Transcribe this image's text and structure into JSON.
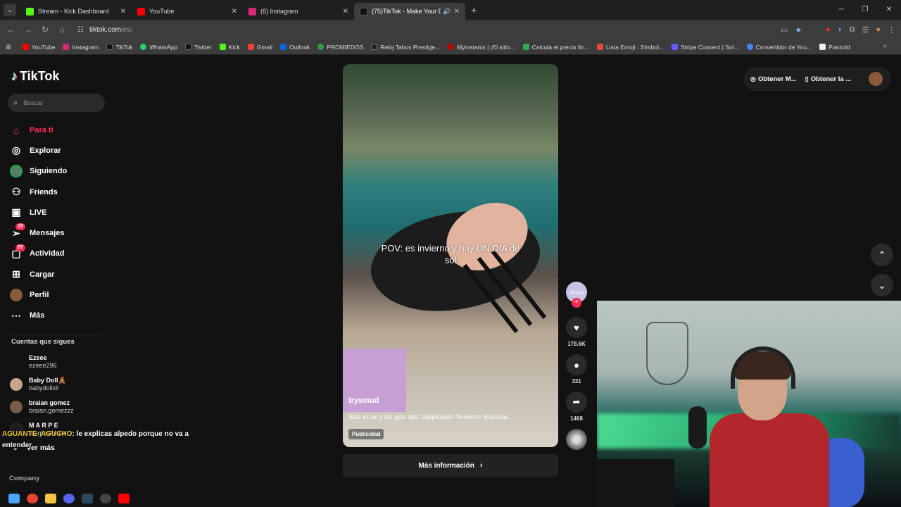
{
  "tabs": [
    {
      "label": "Stream - Kick Dashboard",
      "color": "#53fc18",
      "active": false
    },
    {
      "label": "YouTube",
      "color": "#ff0000",
      "active": false
    },
    {
      "label": "(6) Instagram",
      "color": "#d62976",
      "active": false
    },
    {
      "label": "(75)TikTok - Make Your Day",
      "color": "#111111",
      "active": true
    }
  ],
  "address": {
    "domain": "tiktok.com",
    "path": "/es/"
  },
  "bookmarks": [
    {
      "label": "YouTube",
      "color": "#ff0000"
    },
    {
      "label": "Instagram",
      "color": "#d62976"
    },
    {
      "label": "TikTok",
      "color": "#111111"
    },
    {
      "label": "WhatsApp",
      "color": "#25d366"
    },
    {
      "label": "Twitter",
      "color": "#111111"
    },
    {
      "label": "Kick",
      "color": "#53fc18"
    },
    {
      "label": "Gmail",
      "color": "#ea4335"
    },
    {
      "label": "Outlook",
      "color": "#0a64d6"
    },
    {
      "label": "PROMIEDOS",
      "color": "#2ea043"
    },
    {
      "label": "Reloj Tahos Prestige...",
      "color": "#222222"
    },
    {
      "label": "Myinstants | ¡El sitio...",
      "color": "#c00000"
    },
    {
      "label": "Calculá el precio fin...",
      "color": "#34a853"
    },
    {
      "label": "Lista Emoji : Símbol...",
      "color": "#e8453c"
    },
    {
      "label": "Stripe Connect | Sol...",
      "color": "#635bff"
    },
    {
      "label": "Convertidor de You...",
      "color": "#4285f4"
    },
    {
      "label": "Panzoid",
      "color": "#eeeeee"
    }
  ],
  "sidebar": {
    "logo": "TikTok",
    "search_placeholder": "Buscar",
    "nav": [
      {
        "label": "Para ti",
        "icon": "home-icon",
        "active": true
      },
      {
        "label": "Explorar",
        "icon": "compass-icon"
      },
      {
        "label": "Siguiendo",
        "icon": "following-avatar-icon"
      },
      {
        "label": "Friends",
        "icon": "friends-icon"
      },
      {
        "label": "LIVE",
        "icon": "live-icon"
      },
      {
        "label": "Mensajes",
        "icon": "messages-icon",
        "badge": "18"
      },
      {
        "label": "Actividad",
        "icon": "activity-icon",
        "badge": "57"
      },
      {
        "label": "Cargar",
        "icon": "upload-icon"
      },
      {
        "label": "Perfil",
        "icon": "profile-avatar-icon"
      },
      {
        "label": "Más",
        "icon": "more-icon"
      }
    ],
    "following_title": "Cuentas que sigues",
    "following": [
      {
        "name": "Ezeee",
        "handle": "ezeee296",
        "color": "#111111"
      },
      {
        "name": "Baby Doll🧸",
        "handle": "babydollxll",
        "color": "#c9a48e"
      },
      {
        "name": "braian gomez",
        "handle": "braian.gomezzz",
        "color": "#7a5a48"
      },
      {
        "name": "M A R P E",
        "handle": "marpesthetic",
        "color": "#1c1c1c"
      }
    ],
    "see_more": "Ver más",
    "company": "Company"
  },
  "video": {
    "caption": "POV: es invierno y hay UN DIA de sol",
    "username": "trysmud",
    "description": "Sale el sol y las girls tipo: #depilación #invierno #peludas",
    "ad_label": "Publicidad",
    "cta": "Más información"
  },
  "actions": {
    "creator_label": "smud",
    "likes": "178.6K",
    "comments": "331",
    "shares": "1468"
  },
  "topright": {
    "item1": "Obtener M...",
    "item2": "Obtener la ..."
  },
  "chat": {
    "user": "AGUANTE_AGUCHO",
    "message": ": le explicas alpedo porque no va a entender"
  }
}
